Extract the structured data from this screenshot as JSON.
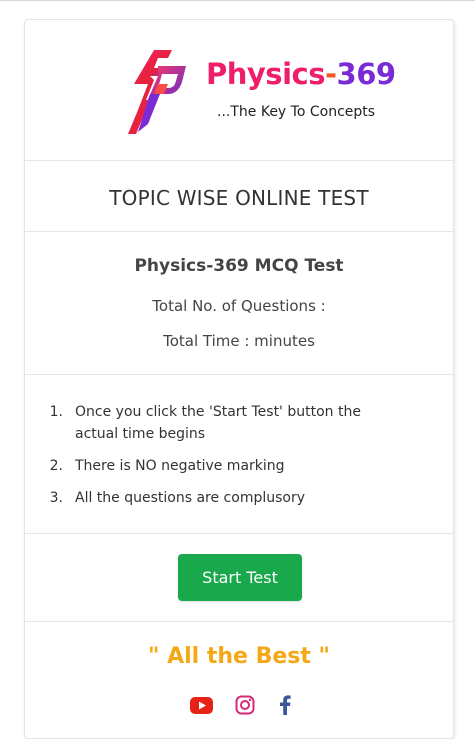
{
  "brand": {
    "name_part1": "Physics",
    "name_part2": "-",
    "name_part3": "369",
    "tagline": "...The Key To Concepts",
    "colors": {
      "pink": "#ee1e6a",
      "orange": "#f05a28",
      "purple": "#7a2bd6"
    },
    "logo_icon": "sp-monogram-icon"
  },
  "header": {
    "title": "TOPIC WISE ONLINE TEST"
  },
  "test": {
    "name": "Physics-369 MCQ Test",
    "questions_label": "Total No. of Questions :",
    "time_label": "Total Time : minutes"
  },
  "rules": [
    {
      "num": "1.",
      "text": "Once you click the 'Start Test' button the actual time begins"
    },
    {
      "num": "2.",
      "text": "There is NO negative marking"
    },
    {
      "num": "3.",
      "text": "All the questions are complusory"
    }
  ],
  "actions": {
    "start_label": "Start Test",
    "start_color": "#19a84b"
  },
  "footer": {
    "wish": "\" All the Best \"",
    "social": [
      {
        "icon": "youtube-icon",
        "color": "#e62117"
      },
      {
        "icon": "instagram-icon",
        "color": "#d62976"
      },
      {
        "icon": "facebook-icon",
        "color": "#3b5998"
      }
    ]
  }
}
